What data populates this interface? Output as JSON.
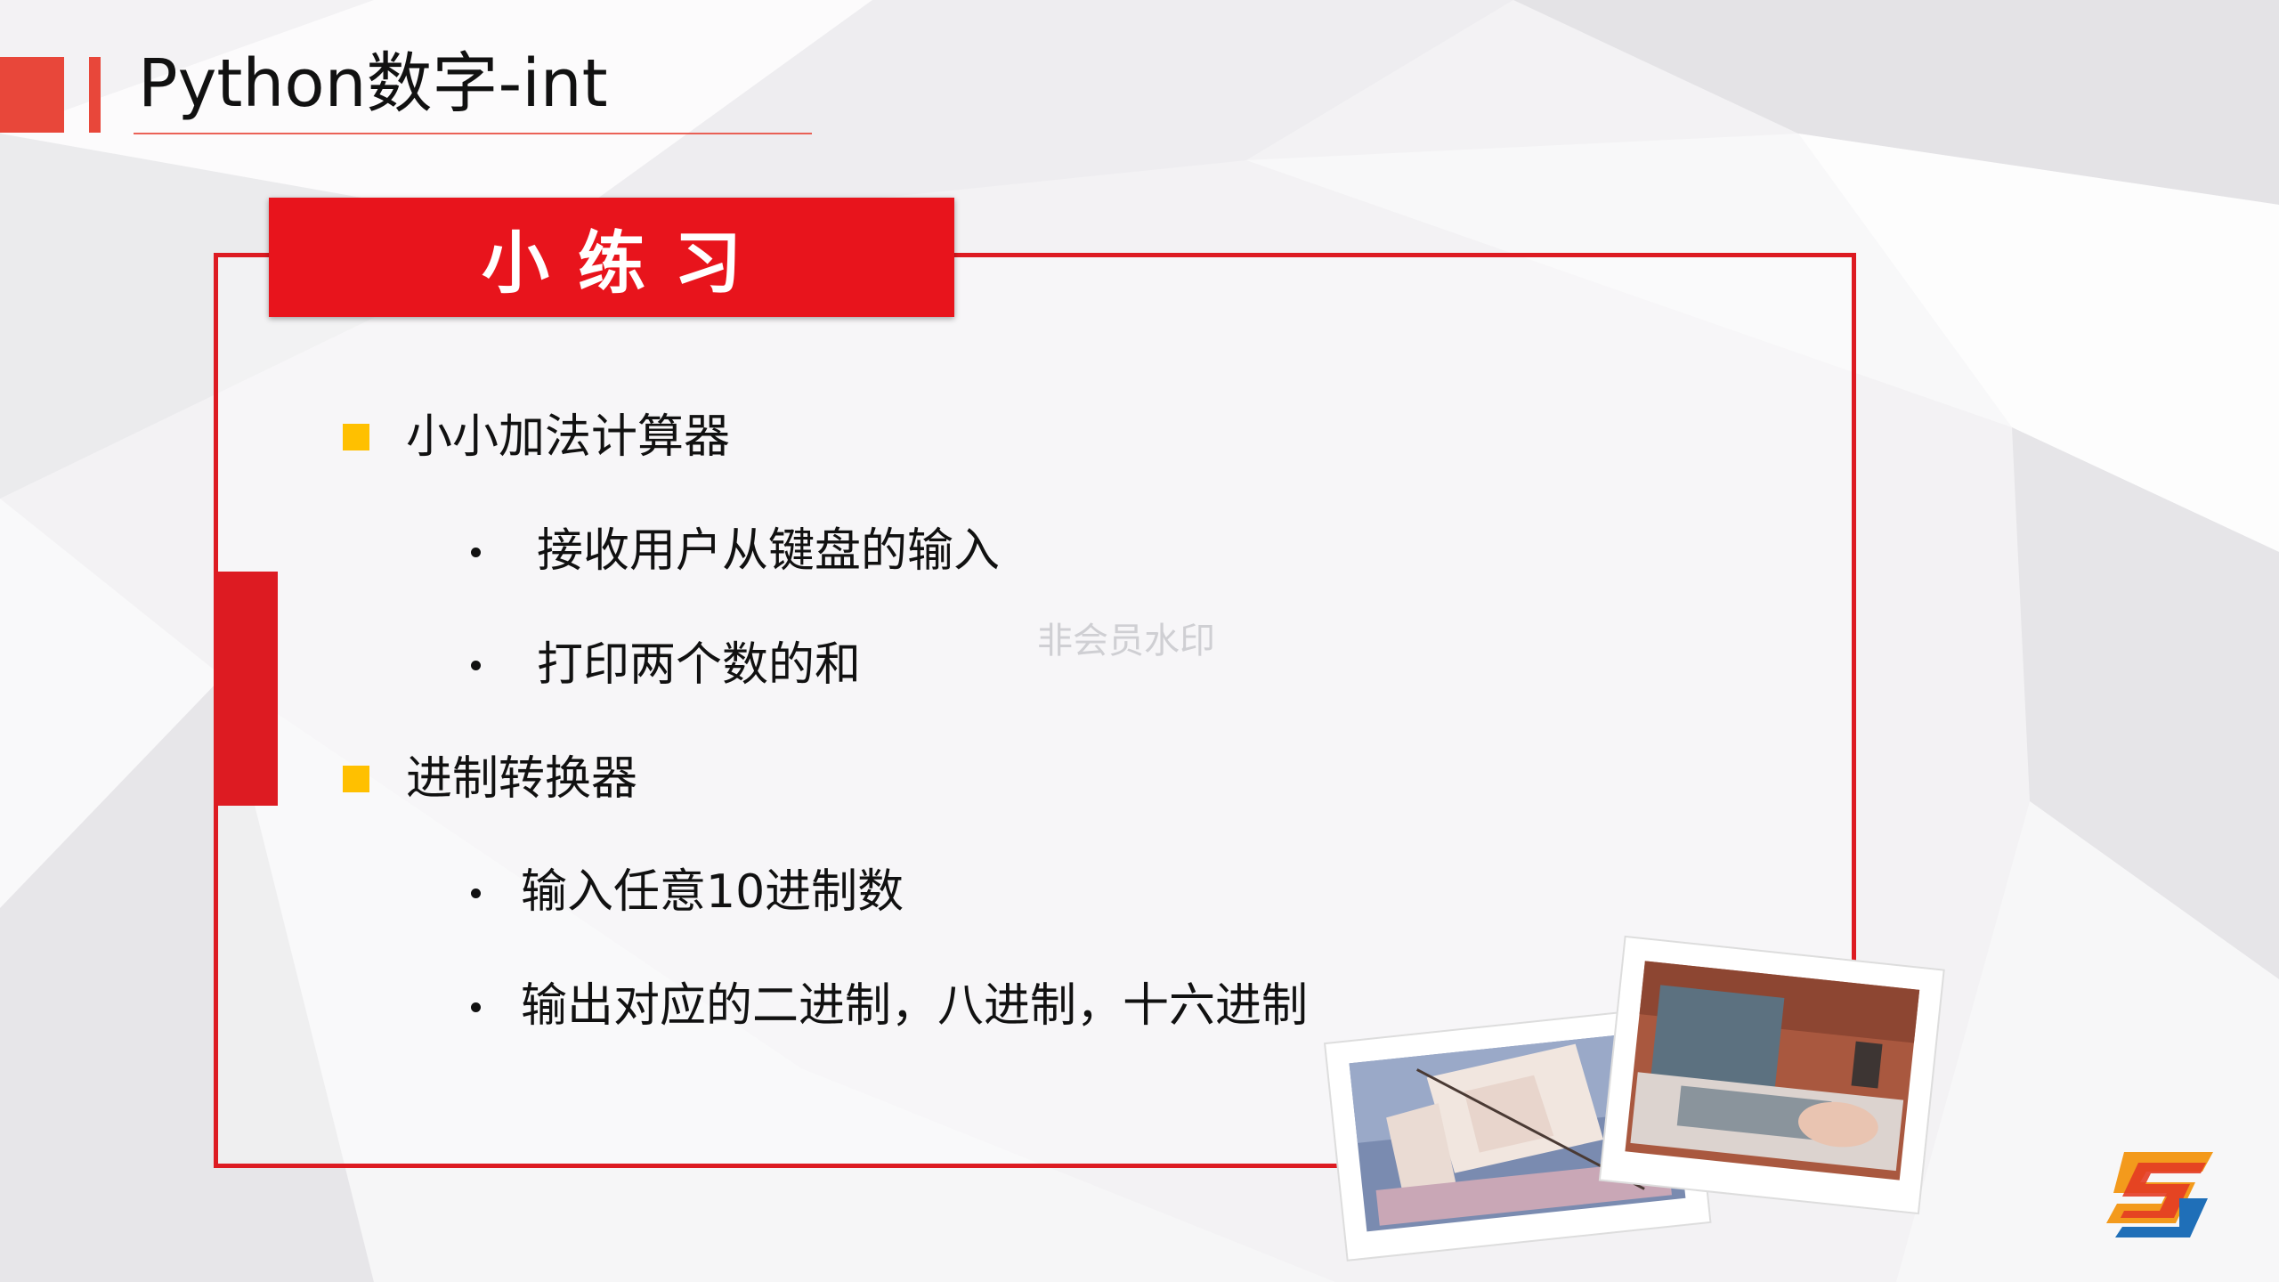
{
  "header": {
    "title": "Python数字-int"
  },
  "banner": {
    "label": "小练习"
  },
  "sections": [
    {
      "label": "小小加法计算器",
      "items": [
        "接收用户从键盘的输入",
        "打印两个数的和"
      ]
    },
    {
      "label": "进制转换器",
      "items": [
        "输入任意10进制数",
        "输出对应的二进制，八进制，十六进制"
      ]
    }
  ],
  "watermark": "非会员水印",
  "colors": {
    "accent_red": "#dd1b22",
    "bullet_yellow": "#ffc000",
    "header_red": "#e8473a"
  },
  "icons": [
    "square-bullet-icon",
    "dot-bullet-icon",
    "brand-logo-icon"
  ]
}
